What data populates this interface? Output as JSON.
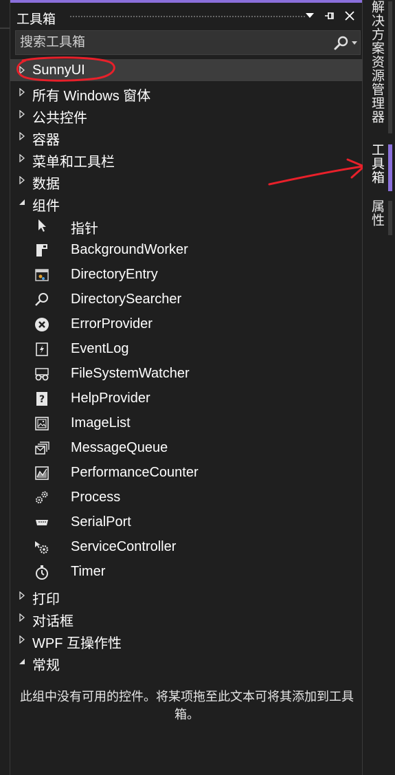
{
  "panel": {
    "title": "工具箱",
    "pin_glyph": "⊣",
    "close_glyph": "✕"
  },
  "search": {
    "placeholder": "搜索工具箱"
  },
  "categories": [
    {
      "label": "SunnyUI",
      "expanded": false,
      "selected": true
    },
    {
      "label": "所有 Windows 窗体",
      "expanded": false
    },
    {
      "label": "公共控件",
      "expanded": false
    },
    {
      "label": "容器",
      "expanded": false
    },
    {
      "label": "菜单和工具栏",
      "expanded": false
    },
    {
      "label": "数据",
      "expanded": false
    },
    {
      "label": "组件",
      "expanded": true
    }
  ],
  "components": [
    {
      "label": "指针",
      "icon": "pointer-icon"
    },
    {
      "label": "BackgroundWorker",
      "icon": "background-worker-icon"
    },
    {
      "label": "DirectoryEntry",
      "icon": "directory-entry-icon"
    },
    {
      "label": "DirectorySearcher",
      "icon": "magnifier-icon"
    },
    {
      "label": "ErrorProvider",
      "icon": "error-icon"
    },
    {
      "label": "EventLog",
      "icon": "event-log-icon"
    },
    {
      "label": "FileSystemWatcher",
      "icon": "binoculars-icon"
    },
    {
      "label": "HelpProvider",
      "icon": "help-icon"
    },
    {
      "label": "ImageList",
      "icon": "image-list-icon"
    },
    {
      "label": "MessageQueue",
      "icon": "message-queue-icon"
    },
    {
      "label": "PerformanceCounter",
      "icon": "performance-counter-icon"
    },
    {
      "label": "Process",
      "icon": "gears-icon"
    },
    {
      "label": "SerialPort",
      "icon": "serial-port-icon"
    },
    {
      "label": "ServiceController",
      "icon": "service-controller-icon"
    },
    {
      "label": "Timer",
      "icon": "stopwatch-icon"
    }
  ],
  "categories_after": [
    {
      "label": "打印",
      "expanded": false
    },
    {
      "label": "对话框",
      "expanded": false
    },
    {
      "label": "WPF 互操作性",
      "expanded": false
    },
    {
      "label": "常规",
      "expanded": true
    }
  ],
  "empty_message": "此组中没有可用的控件。将某项拖至此文本可将其添加到工具箱。",
  "side_tabs": [
    {
      "label": "解决方案资源管理器",
      "active": false
    },
    {
      "label": "工具箱",
      "active": true
    },
    {
      "label": "属性",
      "active": false
    }
  ],
  "colors": {
    "accent": "#8a6fdb",
    "annotation": "#e8202a",
    "background": "#1f1f1f",
    "selected_row": "#3d3d3d"
  }
}
